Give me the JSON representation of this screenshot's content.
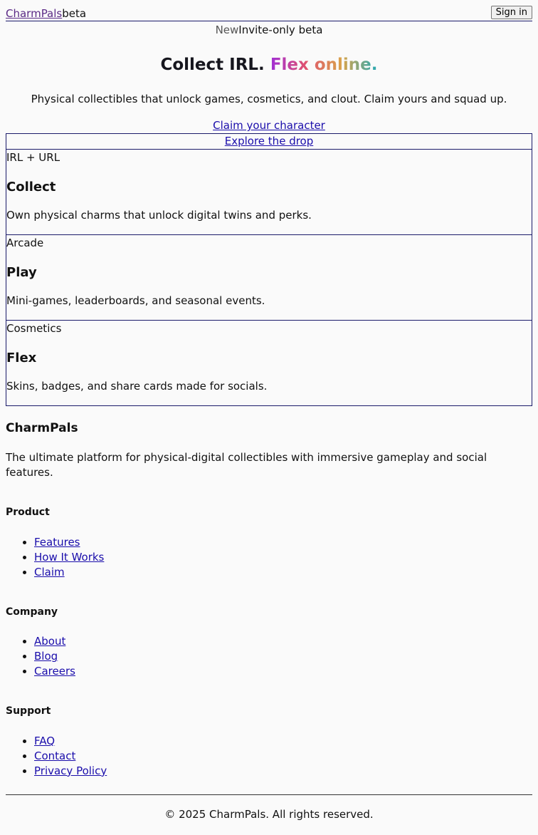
{
  "header": {
    "brand": "CharmPals",
    "badge": "beta",
    "signin_label": "Sign in"
  },
  "announcement": {
    "tag": "New",
    "text": "Invite-only beta"
  },
  "hero": {
    "title_plain": "Collect IRL.",
    "title_gradient": "Flex online.",
    "subtitle": "Physical collectibles that unlock games, cosmetics, and clout. Claim yours and squad up.",
    "cta_primary": "Claim your character",
    "cta_secondary": "Explore the drop"
  },
  "features": [
    {
      "tag": "IRL + URL",
      "title": "Collect",
      "desc": "Own physical charms that unlock digital twins and perks."
    },
    {
      "tag": "Arcade",
      "title": "Play",
      "desc": "Mini-games, leaderboards, and seasonal events."
    },
    {
      "tag": "Cosmetics",
      "title": "Flex",
      "desc": "Skins, badges, and share cards made for socials."
    }
  ],
  "footer": {
    "brand": "CharmPals",
    "description": "The ultimate platform for physical-digital collectibles with immersive gameplay and social features.",
    "columns": [
      {
        "heading": "Product",
        "links": [
          "Features",
          "How It Works",
          "Claim"
        ]
      },
      {
        "heading": "Company",
        "links": [
          "About",
          "Blog",
          "Careers"
        ]
      },
      {
        "heading": "Support",
        "links": [
          "FAQ",
          "Contact",
          "Privacy Policy"
        ]
      }
    ],
    "copyright": "© 2025 CharmPals. All rights reserved."
  }
}
